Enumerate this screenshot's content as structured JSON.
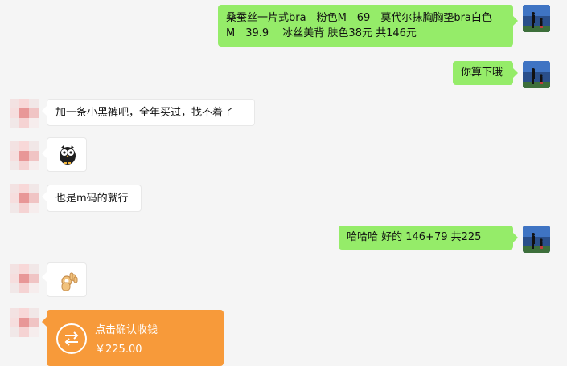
{
  "messages": [
    {
      "sender": "self",
      "lines": [
        "桑蚕丝一片式bra　粉色M　69　莫代尔抹胸胸垫bra白色",
        "M　39.9　 冰丝美背  肤色38元  共146元"
      ]
    },
    {
      "sender": "self",
      "text": "你算下哦"
    },
    {
      "sender": "peer",
      "text": "加一条小黑裤吧，全年买过，找不着了"
    },
    {
      "sender": "peer",
      "type": "sticker",
      "sticker": "owl-emoji"
    },
    {
      "sender": "peer",
      "text": "也是m码的就行"
    },
    {
      "sender": "self",
      "text": "哈哈哈  好的    146+79  共225"
    },
    {
      "sender": "peer",
      "type": "sticker",
      "sticker": "ok-hand-emoji"
    },
    {
      "sender": "peer",
      "type": "transfer",
      "title": "点击确认收钱",
      "amount": "￥225.00"
    }
  ],
  "colors": {
    "background": "#f5f5f5",
    "outgoing_bubble": "#95ec69",
    "incoming_bubble": "#ffffff",
    "transfer_card": "#f79a3a"
  }
}
